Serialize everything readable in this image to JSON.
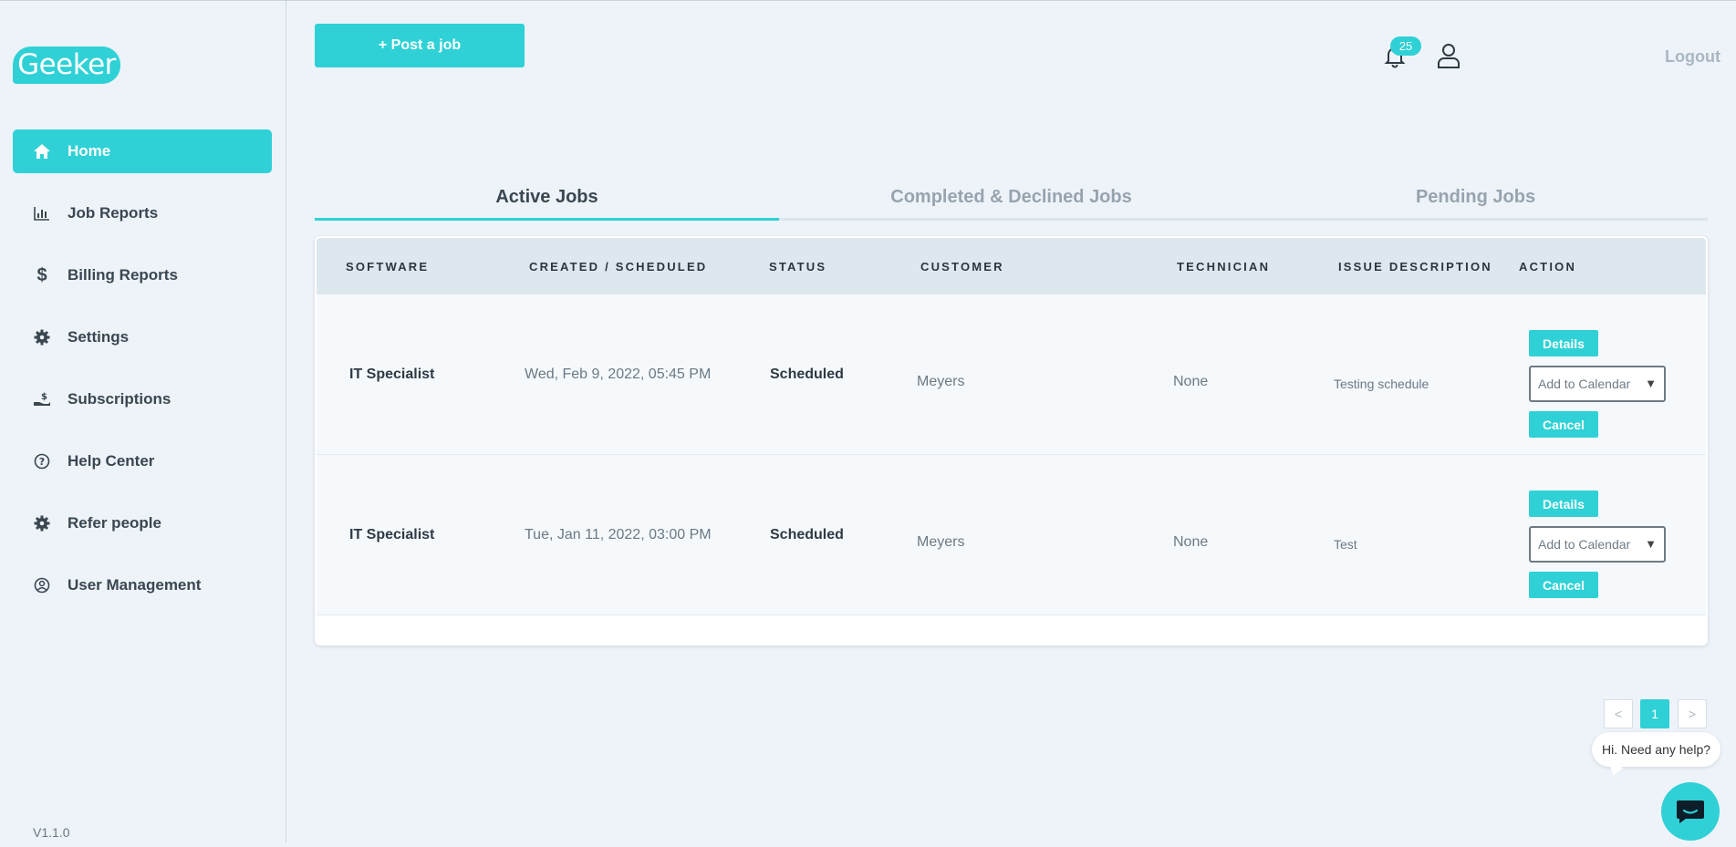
{
  "brand": {
    "logo_text": "Geeker",
    "accent": "#2fd1d6"
  },
  "sidebar": {
    "items": [
      {
        "label": "Home",
        "icon": "home-icon",
        "active": true
      },
      {
        "label": "Job Reports",
        "icon": "bar-chart-icon"
      },
      {
        "label": "Billing Reports",
        "icon": "dollar-icon"
      },
      {
        "label": "Settings",
        "icon": "gear-icon"
      },
      {
        "label": "Subscriptions",
        "icon": "hand-dollar-icon"
      },
      {
        "label": "Help Center",
        "icon": "question-circle-icon"
      },
      {
        "label": "Refer people",
        "icon": "gear-icon"
      },
      {
        "label": "User Management",
        "icon": "user-circle-icon"
      }
    ],
    "version": "V1.1.0"
  },
  "header": {
    "post_job_label": "+ Post a job",
    "notification_count": "25",
    "logout_label": "Logout"
  },
  "tabs": [
    {
      "label": "Active Jobs",
      "active": true
    },
    {
      "label": "Completed & Declined Jobs"
    },
    {
      "label": "Pending Jobs"
    }
  ],
  "table": {
    "columns": [
      "SOFTWARE",
      "CREATED / SCHEDULED",
      "STATUS",
      "CUSTOMER",
      "TECHNICIAN",
      "ISSUE DESCRIPTION",
      "ACTION"
    ],
    "rows": [
      {
        "software": "IT Specialist",
        "date": "Wed, Feb 9, 2022, 05:45 PM",
        "status": "Scheduled",
        "customer": "Meyers",
        "technician": "None",
        "issue": "Testing schedule"
      },
      {
        "software": "IT Specialist",
        "date": "Tue, Jan 11, 2022, 03:00 PM",
        "status": "Scheduled",
        "customer": "Meyers",
        "technician": "None",
        "issue": "Test"
      }
    ],
    "actions": {
      "details_label": "Details",
      "calendar_label": "Add to Calendar",
      "cancel_label": "Cancel"
    }
  },
  "pagination": {
    "prev": "<",
    "current": "1",
    "next": ">"
  },
  "chat": {
    "prompt": "Hi. Need any help?"
  }
}
